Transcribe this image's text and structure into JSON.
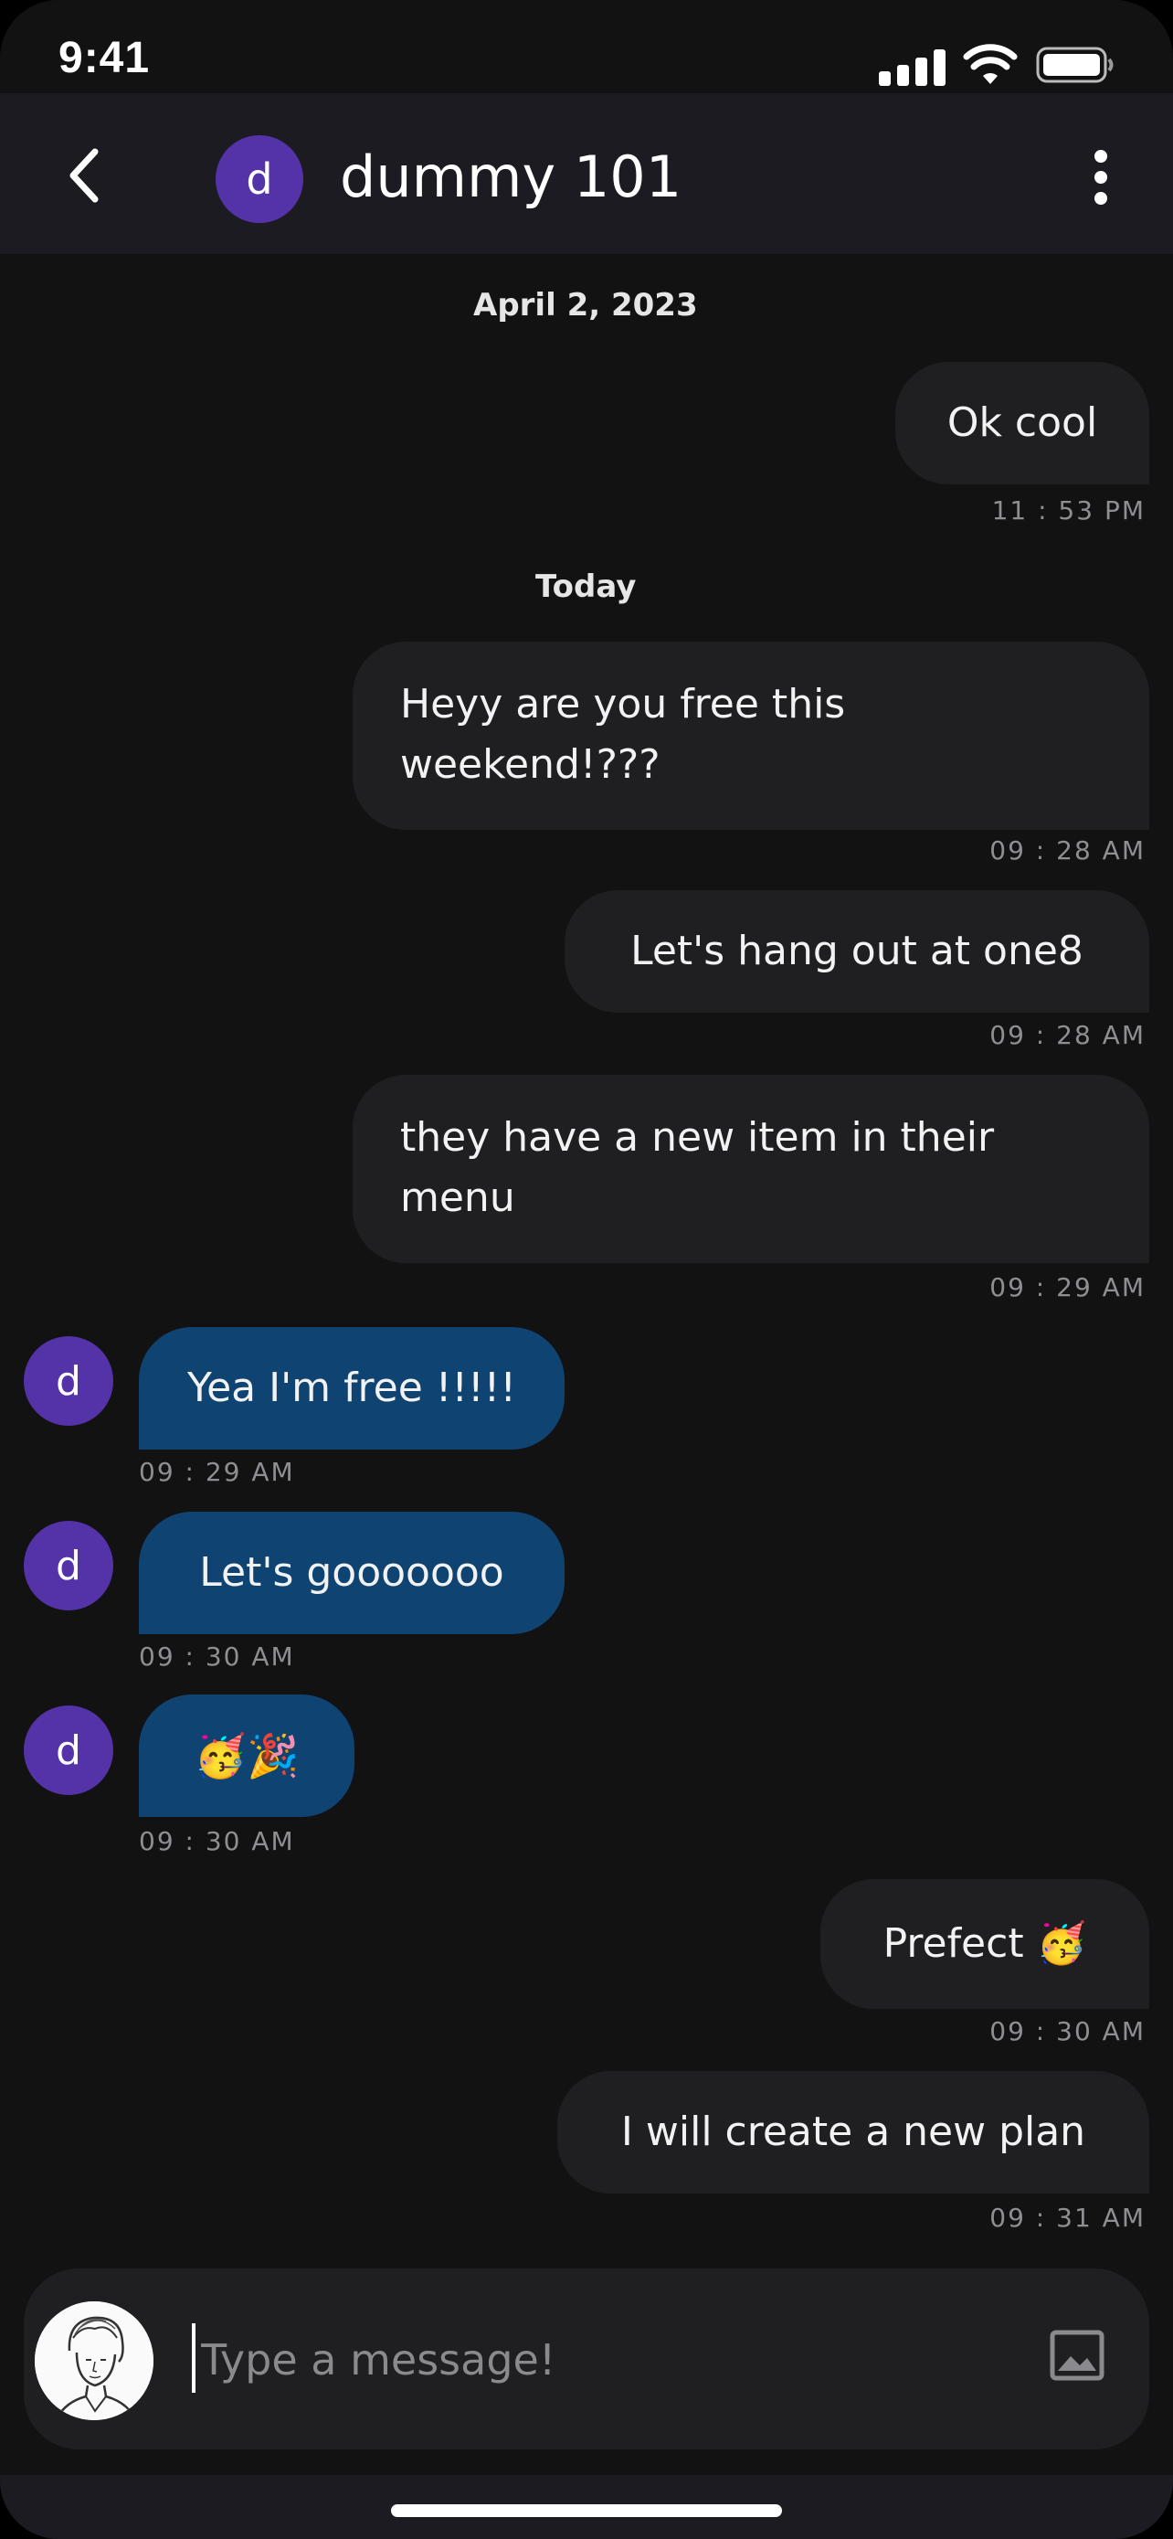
{
  "status_bar": {
    "time": "9:41",
    "icons": [
      "signal-icon",
      "wifi-icon",
      "battery-icon"
    ]
  },
  "header": {
    "back_icon": "chevron-left-icon",
    "avatar_initial": "d",
    "avatar_color": "#5432a8",
    "contact_name": "dummy 101",
    "more_icon": "more-vertical-icon"
  },
  "messages": {
    "date_separators": [
      "April 2, 2023",
      "Today"
    ],
    "items": [
      {
        "direction": "sent",
        "text": "Ok cool",
        "time": "11 : 53  PM"
      },
      {
        "direction": "sent",
        "text": "Heyy are you free this weekend!???",
        "time": "09 : 28  AM"
      },
      {
        "direction": "sent",
        "text": "Let's hang out at one8",
        "time": "09 : 28  AM"
      },
      {
        "direction": "sent",
        "text": "they have a new item in their menu",
        "time": "09 : 29  AM"
      },
      {
        "direction": "received",
        "avatar_initial": "d",
        "text": "Yea I'm free !!!!!",
        "time": "09 : 29  AM"
      },
      {
        "direction": "received",
        "avatar_initial": "d",
        "text": "Let's gooooooo",
        "time": "09 : 30  AM"
      },
      {
        "direction": "received",
        "avatar_initial": "d",
        "text": "🥳🎉",
        "time": "09 : 30  AM"
      },
      {
        "direction": "sent",
        "text": "Prefect",
        "emoji": "🥳",
        "time": "09 : 30  AM"
      },
      {
        "direction": "sent",
        "text": "I will create a new plan",
        "time": "09 : 31  AM"
      }
    ]
  },
  "composer": {
    "placeholder": "Type a message!",
    "value": "",
    "avatar_icon": "user-avatar-icon",
    "attach_icon": "image-icon"
  },
  "colors": {
    "background": "#121212",
    "header_bg": "#1c1b22",
    "sent_bubble": "#1f1f22",
    "received_bubble": "#0f4372",
    "avatar": "#5432a8",
    "timestamp": "#8e8e93"
  }
}
